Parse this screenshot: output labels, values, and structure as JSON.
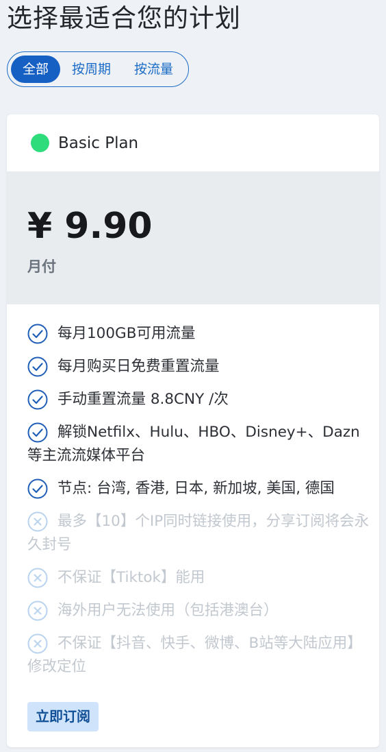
{
  "page": {
    "title": "选择最适合您的计划"
  },
  "tabs": [
    {
      "label": "全部",
      "active": true
    },
    {
      "label": "按周期",
      "active": false
    },
    {
      "label": "按流量",
      "active": false
    }
  ],
  "plan": {
    "name": "Basic Plan",
    "status_color": "#2fdc7c",
    "price": "¥ 9.90",
    "period": "月付",
    "features": [
      {
        "text": "每月100GB可用流量",
        "icon": "check-circle-icon",
        "included": true
      },
      {
        "text": "每月购买日免费重置流量",
        "icon": "check-circle-icon",
        "included": true
      },
      {
        "text": "手动重置流量 8.8CNY /次",
        "icon": "check-circle-icon",
        "included": true
      },
      {
        "text": "解锁Netfilx、Hulu、HBO、Disney+、Dazn等主流流媒体平台",
        "icon": "check-circle-icon",
        "included": true
      },
      {
        "text": "节点: 台湾, 香港, 日本, 新加坡, 美国, 德国",
        "icon": "check-circle-icon",
        "included": true
      },
      {
        "text": "最多【10】个IP同时链接使用，分享订阅将会永久封号",
        "icon": "x-circle-icon",
        "included": false
      },
      {
        "text": "不保证【Tiktok】能用",
        "icon": "x-circle-icon",
        "included": false
      },
      {
        "text": "海外用户无法使用（包括港澳台）",
        "icon": "x-circle-icon",
        "included": false
      },
      {
        "text": "不保证【抖音、快手、微博、B站等大陆应用】修改定位",
        "icon": "x-circle-icon",
        "included": false
      }
    ],
    "subscribe_label": "立即订阅"
  },
  "colors": {
    "accent": "#1a6bc7",
    "check": "#1f5fb8",
    "cross": "#b9d3ee",
    "button_bg": "#cfe3fb"
  }
}
